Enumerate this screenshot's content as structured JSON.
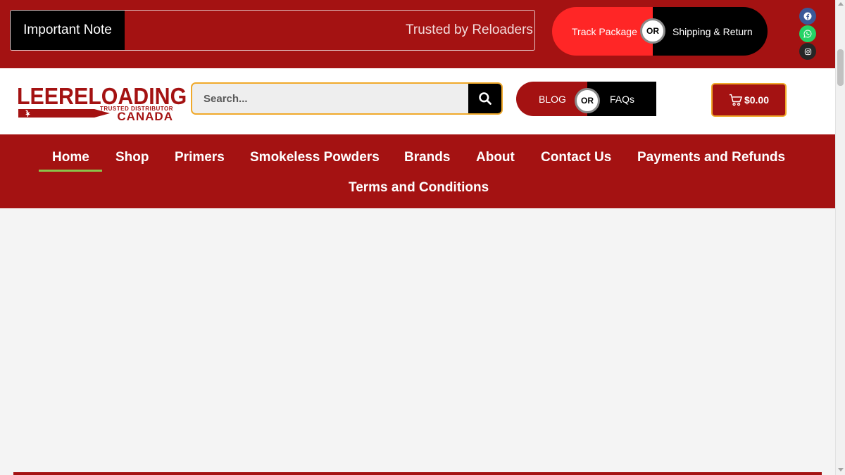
{
  "topbar": {
    "notice_label": "Important Note",
    "notice_text": "Trusted by Reloaders Across Canada",
    "track_package": "Track Package",
    "or": "OR",
    "shipping_return": "Shipping & Return",
    "social": [
      "facebook-icon",
      "whatsapp-icon",
      "instagram-icon"
    ]
  },
  "header": {
    "logo_title": "LEERELOADING",
    "logo_sub": "TRUSTED DISTRIBUTOR",
    "logo_country": "CANADA",
    "search_placeholder": "Search...",
    "blog": "BLOG",
    "or": "OR",
    "faqs": "FAQs",
    "cart_total": "$0.00"
  },
  "nav": {
    "items": [
      "Home",
      "Shop",
      "Primers",
      "Smokeless Powders",
      "Brands",
      "About",
      "Contact Us",
      "Payments and Refunds",
      "Terms and Conditions"
    ],
    "active": "Home"
  },
  "colors": {
    "brand_red": "#a41212",
    "bright_red": "#ff2626",
    "accent_orange": "#f0a92a",
    "active_underline": "#8bc34a"
  }
}
